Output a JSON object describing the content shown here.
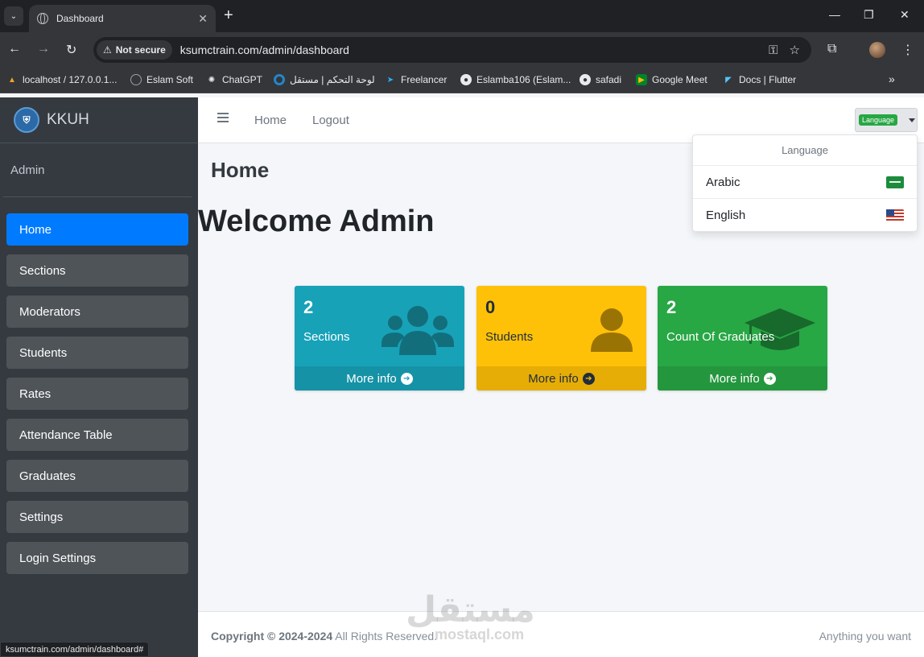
{
  "browser": {
    "tab_title": "Dashboard",
    "secure_label": "Not secure",
    "url": "ksumctrain.com/admin/dashboard",
    "status_url": "ksumctrain.com/admin/dashboard#",
    "bookmarks": [
      {
        "label": "localhost / 127.0.0.1...",
        "icon": "phpmyadmin-icon",
        "color": "#f0a030"
      },
      {
        "label": "Eslam Soft",
        "icon": "globe-icon",
        "color": "#9aa0a6"
      },
      {
        "label": "ChatGPT",
        "icon": "chatgpt-icon",
        "color": "#e8eaed"
      },
      {
        "label": "لوحة التحكم | مستقل",
        "icon": "mostaql-icon",
        "color": "#2386c8"
      },
      {
        "label": "Freelancer",
        "icon": "freelancer-icon",
        "color": "#29b2fe"
      },
      {
        "label": "Eslamba106 (Eslam...",
        "icon": "github-icon",
        "color": "#e8eaed"
      },
      {
        "label": "safadi",
        "icon": "github-icon",
        "color": "#e8eaed"
      },
      {
        "label": "Google Meet",
        "icon": "google-meet-icon",
        "color": "#00832d"
      },
      {
        "label": "Docs | Flutter",
        "icon": "flutter-icon",
        "color": "#54c5f8"
      }
    ]
  },
  "sidebar": {
    "brand": "KKUH",
    "user": "Admin",
    "items": [
      {
        "label": "Home",
        "active": true
      },
      {
        "label": "Sections",
        "active": false
      },
      {
        "label": "Moderators",
        "active": false
      },
      {
        "label": "Students",
        "active": false
      },
      {
        "label": "Rates",
        "active": false
      },
      {
        "label": "Attendance Table",
        "active": false
      },
      {
        "label": "Graduates",
        "active": false
      },
      {
        "label": "Settings",
        "active": false
      },
      {
        "label": "Login Settings",
        "active": false
      }
    ]
  },
  "navbar": {
    "links": [
      "Home",
      "Logout"
    ],
    "language_badge": "Language"
  },
  "dropdown": {
    "header": "Language",
    "items": [
      {
        "label": "Arabic",
        "flag": "saudi-flag-icon"
      },
      {
        "label": "English",
        "flag": "us-flag-icon"
      }
    ]
  },
  "content": {
    "page_title": "Home",
    "welcome": "Welcome Admin",
    "cards": [
      {
        "count": "2",
        "label": "Sections",
        "link": "More info",
        "color": "#17a2b8",
        "icon": "users-icon"
      },
      {
        "count": "0",
        "label": "Students",
        "link": "More info",
        "color": "#ffc107",
        "icon": "user-icon"
      },
      {
        "count": "2",
        "label": "Count Of Graduates",
        "link": "More info",
        "color": "#28a745",
        "icon": "graduation-cap-icon"
      }
    ]
  },
  "footer": {
    "copyright_strong": "Copyright © 2024-2024",
    "copyright_rest": " All Rights Reserved.",
    "right_text": "Anything you want"
  },
  "watermark": {
    "main": "مستقل",
    "sub": "mostaql.com"
  }
}
